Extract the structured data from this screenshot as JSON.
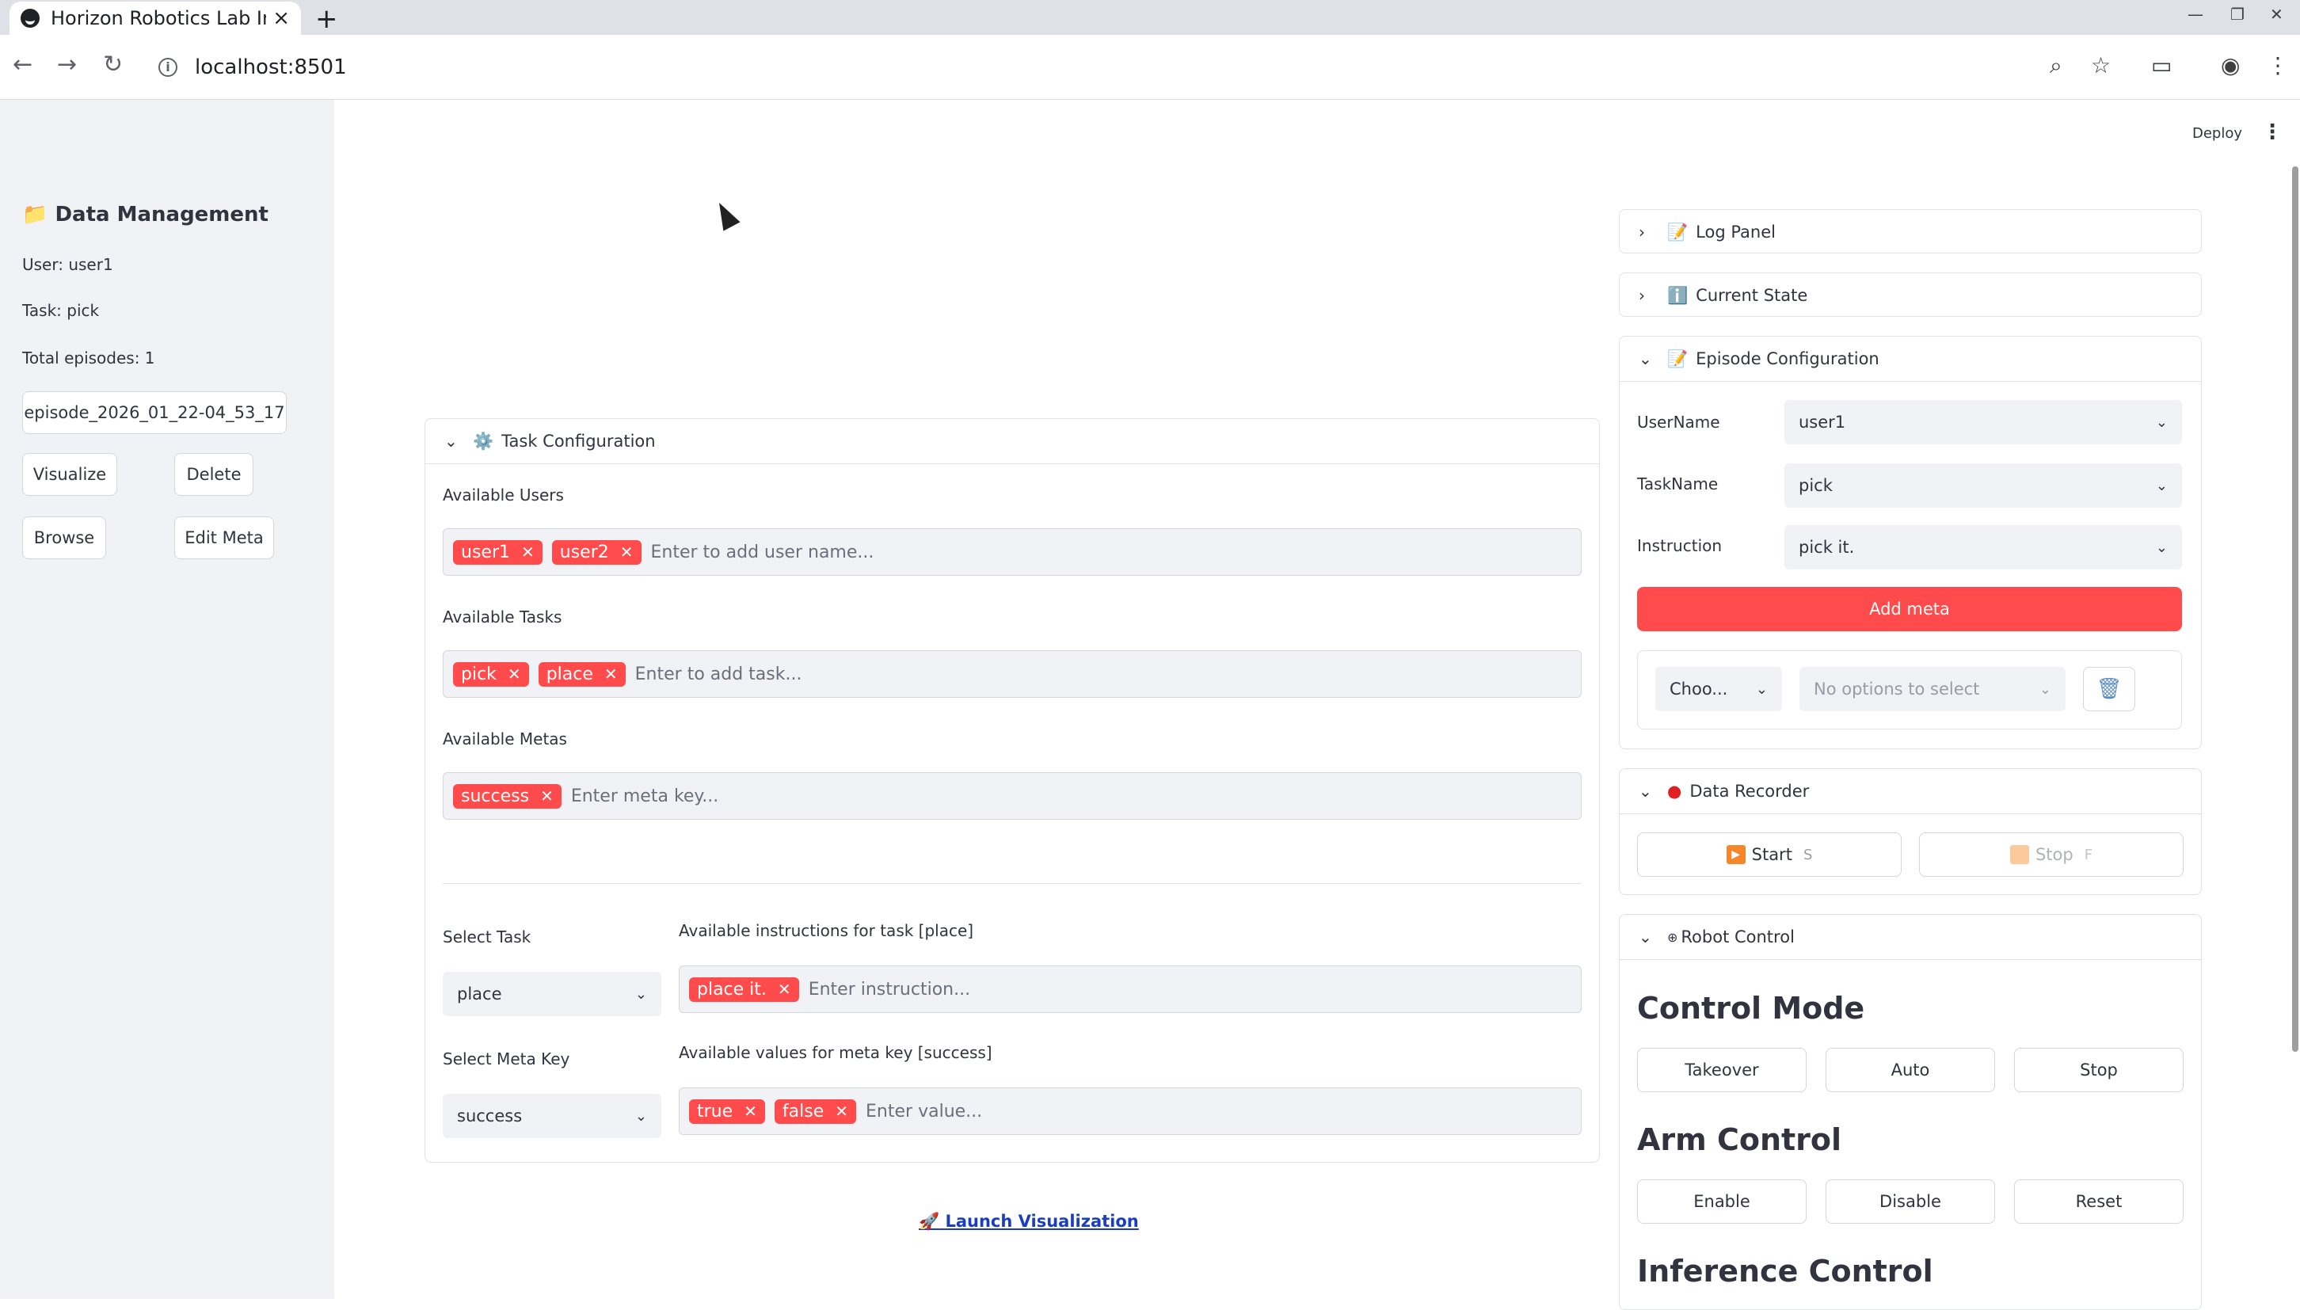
{
  "browser": {
    "tab_title": "Horizon Robotics Lab Inf",
    "url": "localhost:8501"
  },
  "topbar": {
    "deploy": "Deploy"
  },
  "sidebar": {
    "title": "Data Management",
    "user": "User: user1",
    "task": "Task: pick",
    "total": "Total episodes: 1",
    "episode": "episode_2026_01_22-04_53_17",
    "buttons": {
      "visualize": "Visualize",
      "delete": "Delete",
      "browse": "Browse",
      "edit_meta": "Edit Meta"
    }
  },
  "task_config": {
    "title": "Task Configuration",
    "users_label": "Available Users",
    "users": [
      "user1",
      "user2"
    ],
    "users_placeholder": "Enter to add user name...",
    "tasks_label": "Available Tasks",
    "tasks": [
      "pick",
      "place"
    ],
    "tasks_placeholder": "Enter to add task...",
    "metas_label": "Available Metas",
    "metas": [
      "success"
    ],
    "metas_placeholder": "Enter meta key...",
    "select_task_label": "Select Task",
    "select_task_value": "place",
    "instr_label": "Available instructions for task [place]",
    "instructions": [
      "place it."
    ],
    "instr_placeholder": "Enter instruction...",
    "select_meta_label": "Select Meta Key",
    "select_meta_value": "success",
    "values_label": "Available values for meta key [success]",
    "values": [
      "true",
      "false"
    ],
    "values_placeholder": "Enter value..."
  },
  "launch": "Launch Visualization",
  "right": {
    "log_panel": "Log Panel",
    "current_state": "Current State",
    "episode_config": {
      "title": "Episode Configuration",
      "username_label": "UserName",
      "username": "user1",
      "taskname_label": "TaskName",
      "taskname": "pick",
      "instruction_label": "Instruction",
      "instruction": "pick it.",
      "add_meta": "Add meta",
      "choose": "Choo...",
      "no_options": "No options to select"
    },
    "data_recorder": {
      "title": "Data Recorder",
      "start": "Start",
      "start_key": "S",
      "stop": "Stop",
      "stop_key": "F"
    },
    "robot_control": {
      "title": "Robot Control",
      "control_mode": "Control Mode",
      "takeover": "Takeover",
      "auto": "Auto",
      "stop": "Stop",
      "arm_control": "Arm Control",
      "enable": "Enable",
      "disable": "Disable",
      "reset": "Reset",
      "inference_control": "Inference Control"
    }
  },
  "colors": {
    "accent": "#ff4b4b",
    "sidebar": "#f0f2f6",
    "link": "#1a3ebf"
  },
  "icons": {
    "folder": "folder-icon",
    "gear": "gear-icon",
    "memo": "memo-icon",
    "info": "info-icon",
    "red_circle": "record-icon",
    "rocket": "rocket-icon",
    "trash": "trash-icon"
  }
}
